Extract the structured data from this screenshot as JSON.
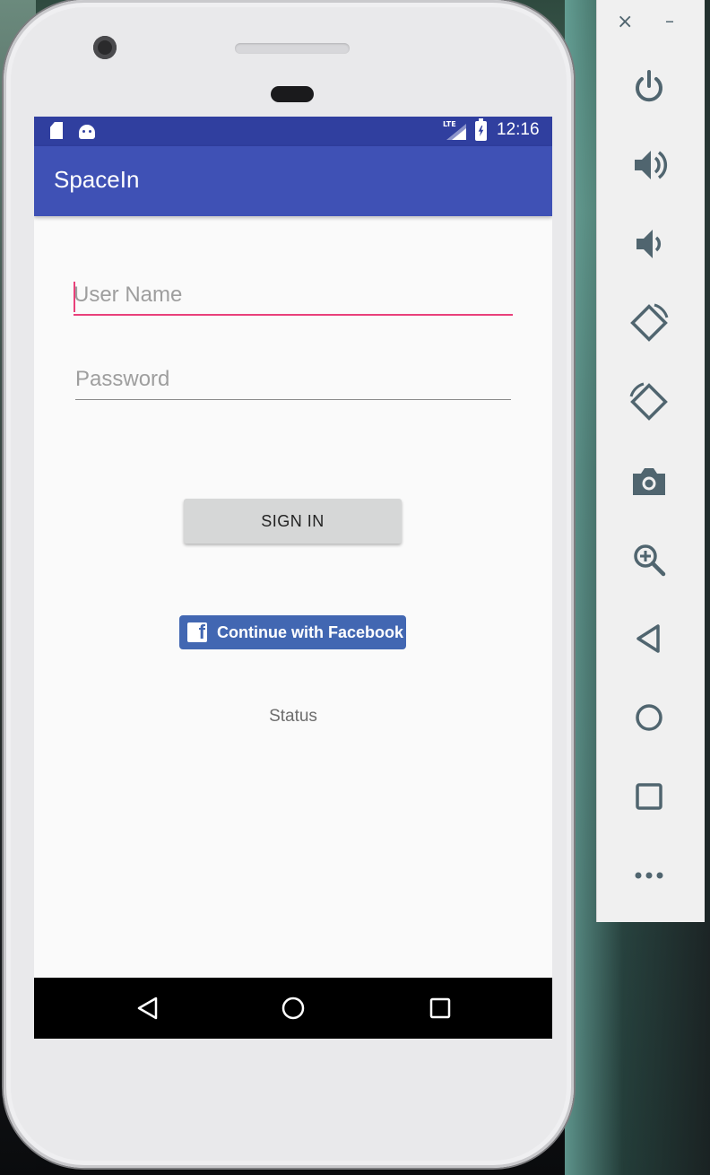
{
  "status_bar": {
    "clock": "12:16",
    "network": "LTE"
  },
  "app_bar": {
    "title": "SpaceIn"
  },
  "form": {
    "username": {
      "placeholder": "User Name",
      "value": ""
    },
    "password": {
      "placeholder": "Password",
      "value": ""
    },
    "sign_in_label": "SIGN IN",
    "facebook_label": "Continue with Facebook",
    "facebook_logo_letter": "f",
    "status_text": "Status"
  },
  "emulator_toolbar": {
    "close_glyph": "×",
    "minimize_glyph": "–",
    "buttons": [
      "power-icon",
      "volume-up-icon",
      "volume-down-icon",
      "rotate-left-icon",
      "rotate-right-icon",
      "camera-icon",
      "zoom-icon",
      "back-icon",
      "home-icon",
      "overview-icon",
      "more-icon"
    ]
  },
  "colors": {
    "primary_dark": "#303f9f",
    "primary": "#3f51b5",
    "accent": "#e9407a",
    "facebook": "#4267b2",
    "toolbar_icon": "#50656f"
  }
}
